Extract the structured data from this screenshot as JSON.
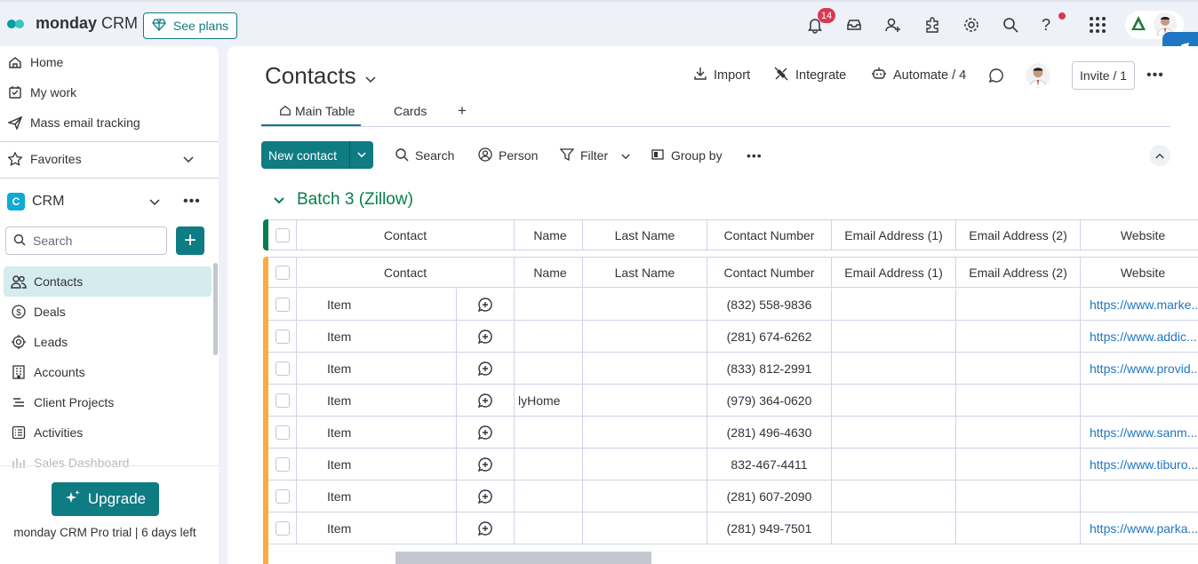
{
  "topbar": {
    "logo_brand": "monday",
    "logo_product": " CRM",
    "see_plans": "See plans",
    "notification_count": "14",
    "icons": [
      "bell-icon",
      "inbox-icon",
      "invite-user-icon",
      "apps-icon",
      "settings-icon",
      "search-icon",
      "help-icon",
      "app-grid-icon"
    ]
  },
  "sidebar": {
    "top_items": [
      {
        "label": "Home",
        "icon": "home-icon"
      },
      {
        "label": "My work",
        "icon": "my-work-icon"
      },
      {
        "label": "Mass email tracking",
        "icon": "send-icon"
      }
    ],
    "favorites": "Favorites",
    "workspace": "CRM",
    "search_placeholder": "Search",
    "items": [
      {
        "label": "Contacts",
        "icon": "contacts-icon"
      },
      {
        "label": "Deals",
        "icon": "dollar-icon"
      },
      {
        "label": "Leads",
        "icon": "target-icon"
      },
      {
        "label": "Accounts",
        "icon": "building-icon"
      },
      {
        "label": "Client Projects",
        "icon": "list-icon"
      },
      {
        "label": "Activities",
        "icon": "activities-icon"
      },
      {
        "label": "Sales Dashboard",
        "icon": "dashboard-icon"
      }
    ],
    "upgrade": "Upgrade",
    "trial_text": "monday CRM Pro trial | 6 days left"
  },
  "board": {
    "title": "Contacts",
    "import": "Import",
    "integrate": "Integrate",
    "automate": "Automate / 4",
    "invite": "Invite / 1",
    "tabs": [
      {
        "label": "Main Table"
      },
      {
        "label": "Cards"
      },
      {
        "label": "+"
      }
    ],
    "new_contact": "New contact",
    "toolbar": {
      "search": "Search",
      "person": "Person",
      "filter": "Filter",
      "group_by": "Group by"
    },
    "group_title": "Batch 3 (Zillow)",
    "columns": {
      "contact": "Contact",
      "first_name": "Name",
      "last_name": "Last Name",
      "contact_number": "Contact Number",
      "email1": "Email Address (1)",
      "email2": "Email Address (2)",
      "website": "Website"
    },
    "rows": [
      {
        "name": "Item",
        "first_name": "",
        "number": "(832) 558-9836",
        "website": "https://www.marke..."
      },
      {
        "name": "Item",
        "first_name": "",
        "number": "(281) 674-6262",
        "website": "https://www.addic..."
      },
      {
        "name": "Item",
        "first_name": "",
        "number": "(833) 812-2991",
        "website": "https://www.provid..."
      },
      {
        "name": "Item",
        "first_name": "lyHome",
        "number": "(979) 364-0620",
        "website": ""
      },
      {
        "name": "Item",
        "first_name": "",
        "number": "(281) 496-4630",
        "website": "https://www.sanm..."
      },
      {
        "name": "Item",
        "first_name": "",
        "number": "832-467-4411",
        "website": "https://www.tiburo..."
      },
      {
        "name": "Item",
        "first_name": "",
        "number": "(281) 607-2090",
        "website": ""
      },
      {
        "name": "Item",
        "first_name": "",
        "number": "(281) 949-7501",
        "website": "https://www.parka..."
      }
    ]
  },
  "colors": {
    "accent": "#0f7b83",
    "group_green": "#037f4c",
    "group_bar_orange": "#fdab3d",
    "link_blue": "#1f76c2",
    "badge_red": "#d83a52"
  }
}
